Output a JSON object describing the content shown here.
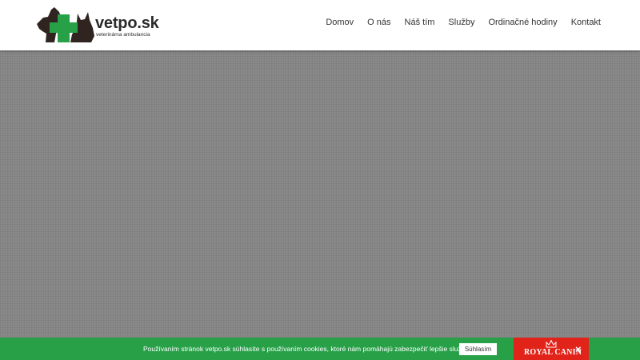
{
  "header": {
    "logo": {
      "name": "vetpo.sk",
      "subtitle": "veterinárna ambulancia"
    },
    "nav": [
      {
        "label": "Domov"
      },
      {
        "label": "O nás"
      },
      {
        "label": "Náš tím"
      },
      {
        "label": "Služby"
      },
      {
        "label": "Ordinačné hodiny"
      },
      {
        "label": "Kontakt"
      }
    ]
  },
  "cookie_bar": {
    "text": "Používaním stránok vetpo.sk súhlasíte s používaním cookies, ktoré nám pomáhajú zabezpečiť lepšie služby.",
    "button_label": "Súhlasím"
  },
  "ad": {
    "brand": "ROYAL CANIN",
    "close_label": "×"
  },
  "colors": {
    "header_bg": "#ffffff",
    "content_bg": "#8a8a8a",
    "cookie_bar_bg": "#27a048",
    "logo_cross": "#27a048",
    "logo_animals": "#2f241f",
    "ad_bg": "#e2231a"
  },
  "icons": {
    "logo_mark": "dog-cat-green-cross-icon",
    "ad_crown": "crown-icon",
    "ad_close": "close-icon"
  }
}
